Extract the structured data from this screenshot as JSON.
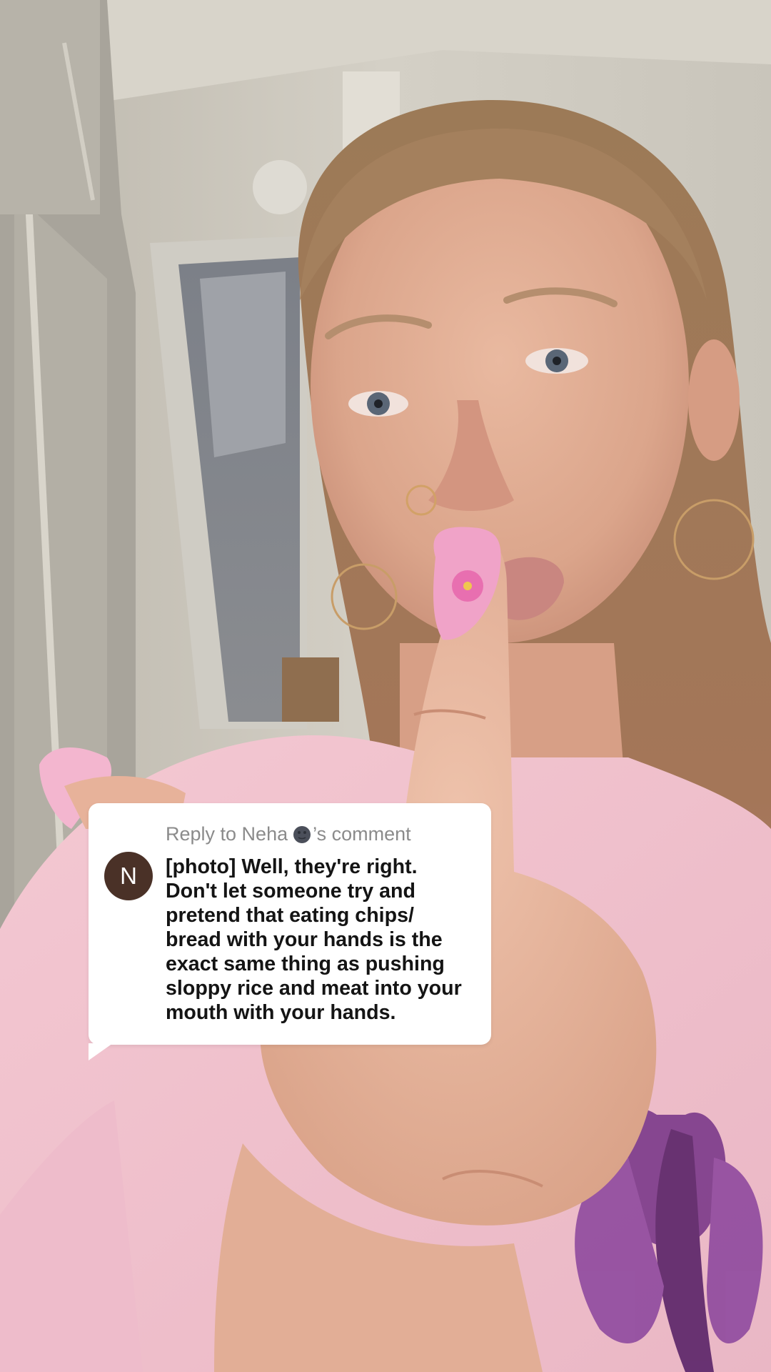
{
  "reply": {
    "header_prefix": "Reply to Neha",
    "header_suffix": "’s comment",
    "avatar_initial": "N",
    "comment_text": "[photo] Well, they're right. Don't let someone try and pretend that eating chips/ bread with your hands is the exact same thing as pushing sloppy rice and meat into your mouth with your hands.",
    "header_emoji": "new-moon-face-icon"
  },
  "colors": {
    "avatar_bg": "#4a3127",
    "header_text": "#8b8b8b",
    "body_text": "#141414",
    "card_bg": "#ffffff"
  }
}
